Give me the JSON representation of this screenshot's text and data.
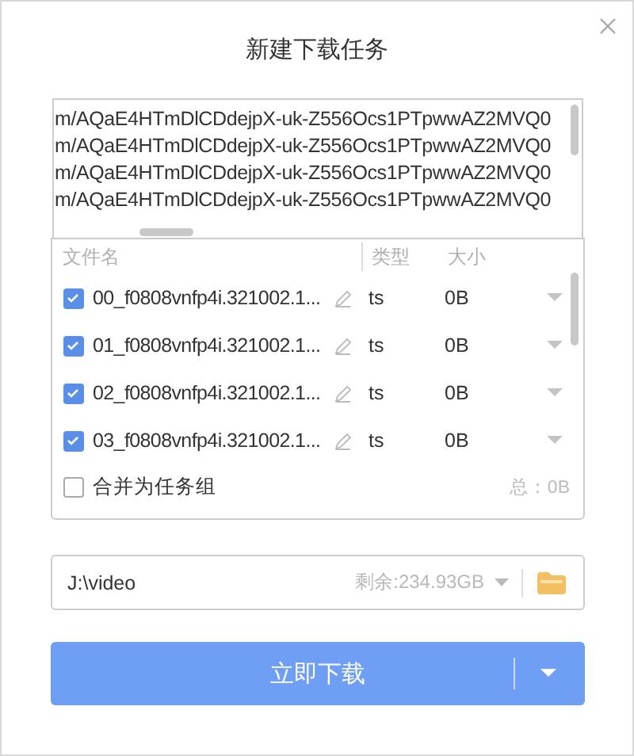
{
  "dialog": {
    "title": "新建下载任务"
  },
  "urls": [
    "m/AQaE4HTmDlCDdejpX-uk-Z556Ocs1PTpwwAZ2MVQ0",
    "m/AQaE4HTmDlCDdejpX-uk-Z556Ocs1PTpwwAZ2MVQ0",
    "m/AQaE4HTmDlCDdejpX-uk-Z556Ocs1PTpwwAZ2MVQ0",
    "m/AQaE4HTmDlCDdejpX-uk-Z556Ocs1PTpwwAZ2MVQ0"
  ],
  "file_list": {
    "columns": [
      "文件名",
      "类型",
      "大小"
    ],
    "files": [
      {
        "name": "00_f0808vnfp4i.321002.1...",
        "type": "ts",
        "size": "0B",
        "checked": true
      },
      {
        "name": "01_f0808vnfp4i.321002.1...",
        "type": "ts",
        "size": "0B",
        "checked": true
      },
      {
        "name": "02_f0808vnfp4i.321002.1...",
        "type": "ts",
        "size": "0B",
        "checked": true
      },
      {
        "name": "03_f0808vnfp4i.321002.1...",
        "type": "ts",
        "size": "0B",
        "checked": true
      }
    ],
    "merge": {
      "label": "合并为任务组",
      "checked": false
    },
    "total": "总：0B"
  },
  "save_path": {
    "value": "J:\\video",
    "free_space": "剩余:234.93GB"
  },
  "download_button": {
    "label": "立即下载"
  }
}
